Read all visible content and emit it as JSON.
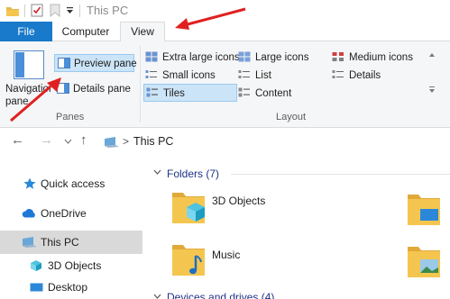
{
  "window": {
    "title": "This PC"
  },
  "tabs": {
    "file": "File",
    "computer": "Computer",
    "view": "View"
  },
  "ribbon": {
    "panes": {
      "navigation_pane": "Navigation pane",
      "preview_pane": "Preview pane",
      "details_pane": "Details pane",
      "group_label": "Panes"
    },
    "layout": {
      "extra_large_icons": "Extra large icons",
      "large_icons": "Large icons",
      "medium_icons": "Medium icons",
      "small_icons": "Small icons",
      "list": "List",
      "details": "Details",
      "tiles": "Tiles",
      "content": "Content",
      "group_label": "Layout"
    }
  },
  "address": {
    "path": "This PC"
  },
  "nav": {
    "items": [
      {
        "label": "Quick access",
        "icon": "star-icon"
      },
      {
        "label": "OneDrive",
        "icon": "cloud-icon"
      },
      {
        "label": "This PC",
        "icon": "computer-icon",
        "selected": true
      },
      {
        "label": "3D Objects",
        "icon": "cube-icon"
      },
      {
        "label": "Desktop",
        "icon": "desktop-icon"
      }
    ]
  },
  "content": {
    "folders_header": "Folders (7)",
    "devices_header": "Devices and drives (4)",
    "folders": [
      {
        "name": "3D Objects"
      },
      {
        "name": "Music"
      }
    ]
  },
  "colors": {
    "accent": "#1979ca",
    "selection": "#cce4f7",
    "annotation": "#e02020",
    "folder": "#f5c64f"
  }
}
